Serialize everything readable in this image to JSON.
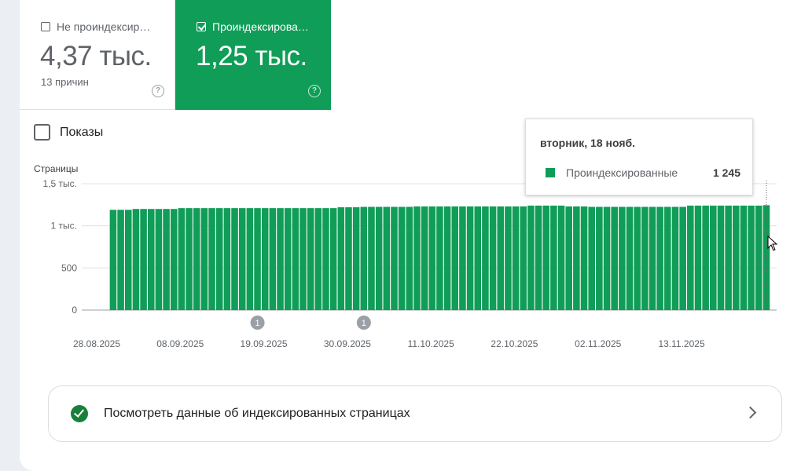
{
  "tiles": {
    "not_indexed": {
      "label": "Не проиндексир…",
      "value": "4,37 тыс.",
      "sub": "13 причин",
      "checked": false,
      "help_icon": "help-circle-icon"
    },
    "indexed": {
      "label": "Проиндексирова…",
      "value": "1,25 тыс.",
      "checked": true,
      "help_icon": "help-circle-icon"
    }
  },
  "impressions_toggle": {
    "label": "Показы",
    "checked": false
  },
  "tooltip": {
    "date": "вторник, 18 нояб.",
    "series": "Проиндексированные",
    "value": "1 245"
  },
  "link_card": {
    "text": "Посмотреть данные об индексированных страницах",
    "icon": "check-circle-icon",
    "chevron": "chevron-right-icon"
  },
  "colors": {
    "indexed": "#109d58",
    "grid": "#e0e0e0"
  },
  "chart_data": {
    "type": "bar",
    "ylabel": "Страницы",
    "yticks": [
      "0",
      "500",
      "1 тыс.",
      "1,5 тыс."
    ],
    "ylim": [
      0,
      1500
    ],
    "xtick_labels": [
      "28.08.2025",
      "08.09.2025",
      "19.09.2025",
      "30.09.2025",
      "11.10.2025",
      "22.10.2025",
      "02.11.2025",
      "13.11.2025"
    ],
    "start_date": "2025-08-28",
    "annotations": [
      {
        "label": "1",
        "date": "2025-09-19"
      },
      {
        "label": "1",
        "date": "2025-10-03"
      }
    ],
    "series": [
      {
        "name": "Проиндексированные",
        "values": [
          null,
          null,
          null,
          1190,
          1190,
          1190,
          1200,
          1200,
          1200,
          1200,
          1200,
          1200,
          1210,
          1210,
          1210,
          1210,
          1210,
          1210,
          1210,
          1210,
          1210,
          1210,
          1210,
          1210,
          1210,
          1210,
          1210,
          1210,
          1210,
          1210,
          1210,
          1210,
          1210,
          1220,
          1220,
          1220,
          1225,
          1225,
          1225,
          1225,
          1225,
          1225,
          1225,
          1230,
          1230,
          1230,
          1230,
          1230,
          1230,
          1230,
          1230,
          1230,
          1230,
          1230,
          1230,
          1230,
          1230,
          1230,
          1240,
          1240,
          1240,
          1240,
          1240,
          1230,
          1230,
          1230,
          1225,
          1225,
          1225,
          1225,
          1225,
          1225,
          1225,
          1225,
          1225,
          1225,
          1225,
          1225,
          1225,
          1240,
          1240,
          1240,
          1240,
          1240,
          1240,
          1240,
          1240,
          1240,
          1240,
          1245
        ]
      }
    ]
  }
}
